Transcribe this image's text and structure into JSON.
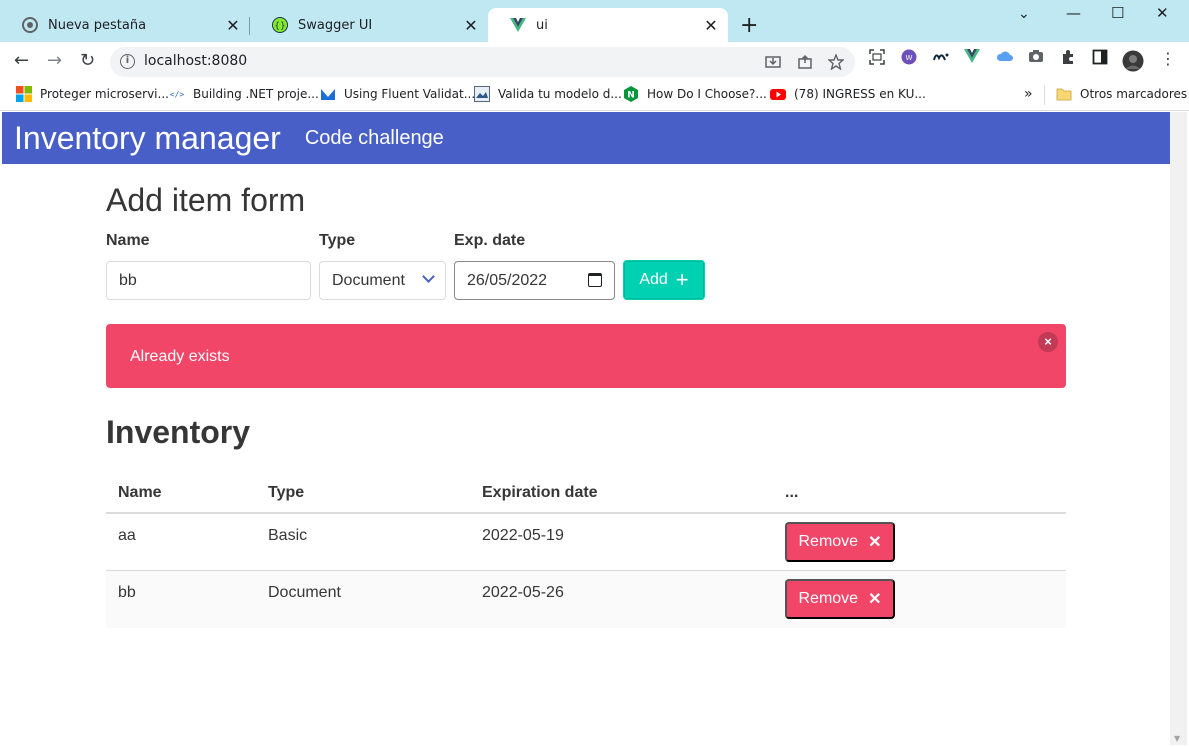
{
  "browser": {
    "tabs": [
      {
        "title": "Nueva pestaña"
      },
      {
        "title": "Swagger UI"
      },
      {
        "title": "ui"
      }
    ],
    "new_tab": "+",
    "window_controls": {
      "minimize": "—",
      "maximize": "☐",
      "close": "✕",
      "tab_list": "⌄"
    },
    "nav": {
      "back": "←",
      "forward": "→",
      "reload": "↻"
    },
    "url": "localhost:8080",
    "bookmarks": [
      {
        "label": "Proteger microservi..."
      },
      {
        "label": "Building .NET proje..."
      },
      {
        "label": "Using Fluent Validat..."
      },
      {
        "label": "Valida tu modelo d..."
      },
      {
        "label": "How Do I Choose?..."
      },
      {
        "label": "(78) INGRESS en KU..."
      }
    ],
    "bookmarks_more": "»",
    "other_bookmarks": "Otros marcadores"
  },
  "app": {
    "brand": "Inventory manager",
    "nav_link": "Code challenge",
    "accent_color": "#485fc7"
  },
  "form": {
    "title": "Add item form",
    "name_label": "Name",
    "name_value": "bb",
    "type_label": "Type",
    "type_value": "Document",
    "date_label": "Exp. date",
    "date_value": "26/05/2022",
    "add_label": "Add",
    "add_icon": "+"
  },
  "notification": {
    "text": "Already exists",
    "close": "×"
  },
  "inventory": {
    "title": "Inventory",
    "columns": [
      "Name",
      "Type",
      "Expiration date",
      "..."
    ],
    "rows": [
      {
        "name": "aa",
        "type": "Basic",
        "date": "2022-05-19",
        "action": "Remove"
      },
      {
        "name": "bb",
        "type": "Document",
        "date": "2022-05-26",
        "action": "Remove"
      }
    ],
    "remove_icon": "✕"
  }
}
